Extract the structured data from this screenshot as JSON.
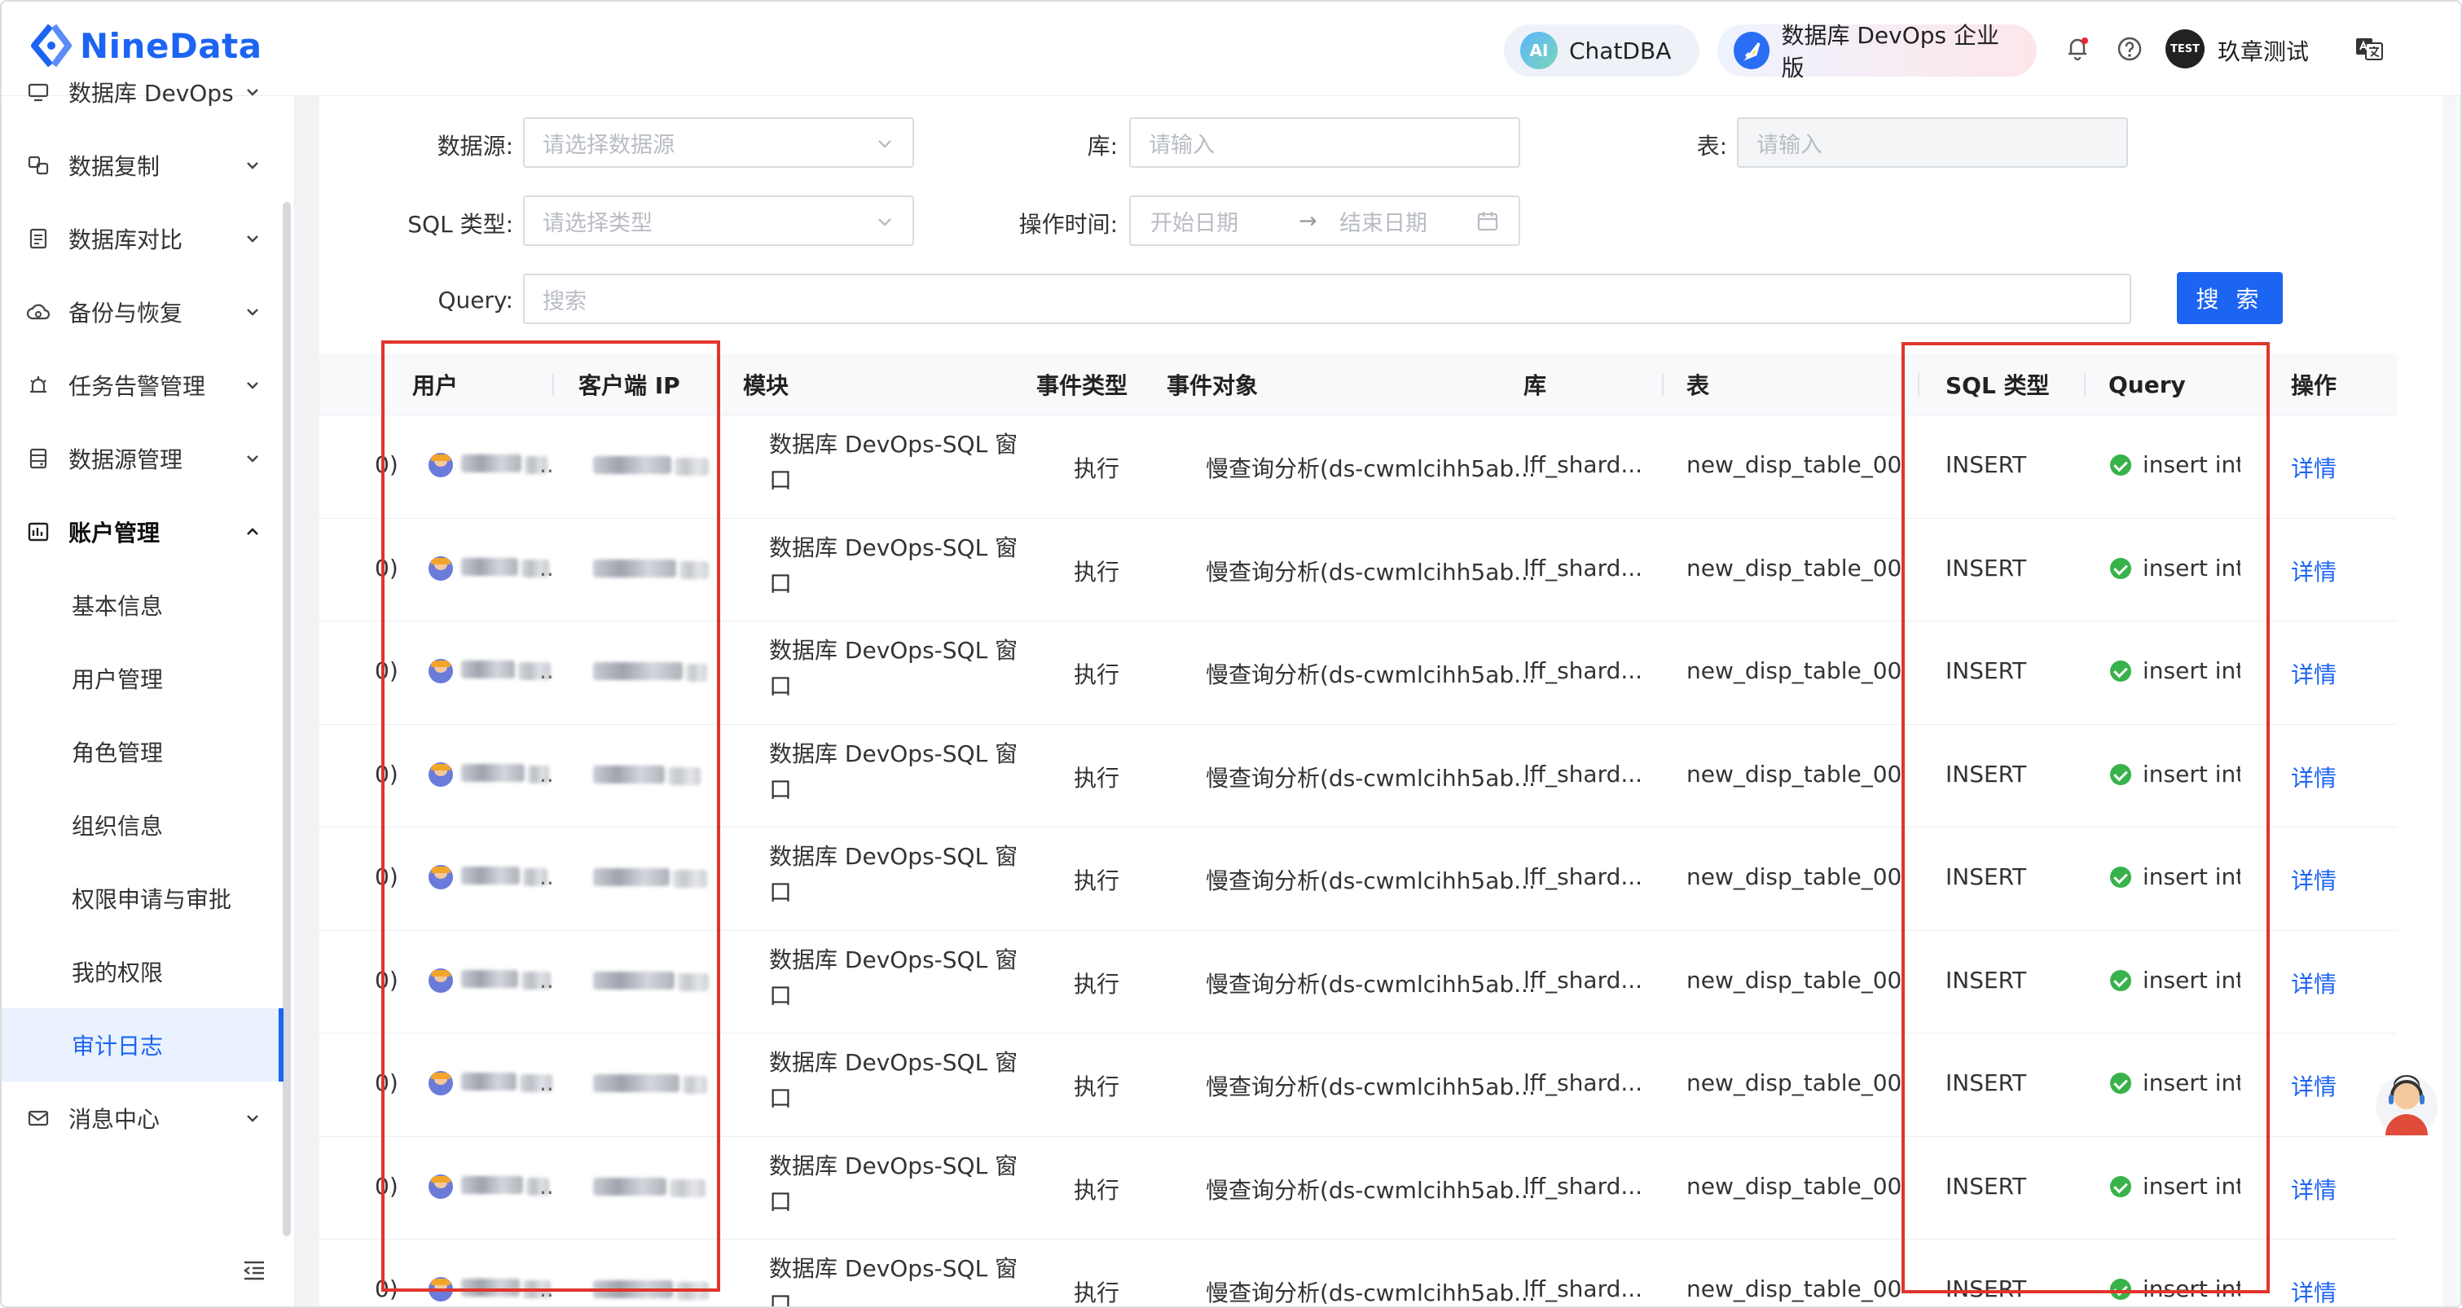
{
  "app": {
    "logo_text": "NineData",
    "brand_color": "#1c64f2"
  },
  "header": {
    "chatdba_label": "ChatDBA",
    "chatdba_icon_text": "AI",
    "devops_label": "数据库 DevOps 企业版",
    "user_badge": "TEST",
    "user_name": "玖章测试"
  },
  "sidebar": {
    "items": [
      {
        "label": "数据库 DevOps",
        "icon": "devops-icon",
        "expanded": false
      },
      {
        "label": "数据复制",
        "icon": "replication-icon",
        "expanded": false
      },
      {
        "label": "数据库对比",
        "icon": "compare-icon",
        "expanded": false
      },
      {
        "label": "备份与恢复",
        "icon": "backup-icon",
        "expanded": false
      },
      {
        "label": "任务告警管理",
        "icon": "alarm-icon",
        "expanded": false
      },
      {
        "label": "数据源管理",
        "icon": "datasource-icon",
        "expanded": false
      },
      {
        "label": "账户管理",
        "icon": "account-icon",
        "expanded": true
      },
      {
        "label": "消息中心",
        "icon": "message-icon",
        "expanded": false
      }
    ],
    "sub_items": [
      "基本信息",
      "用户管理",
      "角色管理",
      "组织信息",
      "权限申请与审批",
      "我的权限",
      "审计日志"
    ],
    "active_sub": "审计日志"
  },
  "filters": {
    "datasource_label": "数据源:",
    "datasource_placeholder": "请选择数据源",
    "db_label": "库:",
    "db_placeholder": "请输入",
    "table_label": "表:",
    "table_placeholder": "请输入",
    "sqltype_label": "SQL 类型:",
    "sqltype_placeholder": "请选择类型",
    "optime_label": "操作时间:",
    "start_placeholder": "开始日期",
    "end_placeholder": "结束日期",
    "date_separator": "→",
    "query_label": "Query:",
    "query_placeholder": "搜索",
    "search_button": "搜 索"
  },
  "table": {
    "columns": [
      "用户",
      "客户端 IP",
      "模块",
      "事件类型",
      "事件对象",
      "库",
      "表",
      "SQL 类型",
      "Query",
      "操作"
    ],
    "rows": [
      {
        "lead": "0)",
        "user_suffix": "..",
        "module": "数据库 DevOps-SQL 窗口",
        "event_type": "执行",
        "event_object": "慢查询分析(ds-cwmlcihh5ab...",
        "db": "lff_shard...",
        "table": "new_disp_table_00",
        "sql_type": "INSERT",
        "query": "insert into r",
        "action": "详情"
      },
      {
        "lead": "0)",
        "user_suffix": "..",
        "module": "数据库 DevOps-SQL 窗口",
        "event_type": "执行",
        "event_object": "慢查询分析(ds-cwmlcihh5ab...",
        "db": "lff_shard...",
        "table": "new_disp_table_00",
        "sql_type": "INSERT",
        "query": "insert into r",
        "action": "详情"
      },
      {
        "lead": "0)",
        "user_suffix": "..",
        "module": "数据库 DevOps-SQL 窗口",
        "event_type": "执行",
        "event_object": "慢查询分析(ds-cwmlcihh5ab...",
        "db": "lff_shard...",
        "table": "new_disp_table_00",
        "sql_type": "INSERT",
        "query": "insert into r",
        "action": "详情"
      },
      {
        "lead": "0)",
        "user_suffix": "..",
        "module": "数据库 DevOps-SQL 窗口",
        "event_type": "执行",
        "event_object": "慢查询分析(ds-cwmlcihh5ab...",
        "db": "lff_shard...",
        "table": "new_disp_table_00",
        "sql_type": "INSERT",
        "query": "insert into r",
        "action": "详情"
      },
      {
        "lead": "0)",
        "user_suffix": "..",
        "module": "数据库 DevOps-SQL 窗口",
        "event_type": "执行",
        "event_object": "慢查询分析(ds-cwmlcihh5ab...",
        "db": "lff_shard...",
        "table": "new_disp_table_00",
        "sql_type": "INSERT",
        "query": "insert into r",
        "action": "详情"
      },
      {
        "lead": "0)",
        "user_suffix": "..",
        "module": "数据库 DevOps-SQL 窗口",
        "event_type": "执行",
        "event_object": "慢查询分析(ds-cwmlcihh5ab...",
        "db": "lff_shard...",
        "table": "new_disp_table_00",
        "sql_type": "INSERT",
        "query": "insert into r",
        "action": "详情"
      },
      {
        "lead": "0)",
        "user_suffix": "..",
        "module": "数据库 DevOps-SQL 窗口",
        "event_type": "执行",
        "event_object": "慢查询分析(ds-cwmlcihh5ab...",
        "db": "lff_shard...",
        "table": "new_disp_table_00",
        "sql_type": "INSERT",
        "query": "insert into r",
        "action": "详情"
      },
      {
        "lead": "0)",
        "user_suffix": "..",
        "module": "数据库 DevOps-SQL 窗口",
        "event_type": "执行",
        "event_object": "慢查询分析(ds-cwmlcihh5ab...",
        "db": "lff_shard...",
        "table": "new_disp_table_00",
        "sql_type": "INSERT",
        "query": "insert into r",
        "action": "详情"
      },
      {
        "lead": "0)",
        "user_suffix": "..",
        "module": "数据库 DevOps-SQL 窗口",
        "event_type": "执行",
        "event_object": "慢查询分析(ds-cwmlcihh5ab...",
        "db": "lff_shard...",
        "table": "new_disp_table_00",
        "sql_type": "INSERT",
        "query": "insert into r",
        "action": "详情"
      }
    ]
  },
  "colors": {
    "highlight": "#e0352b",
    "success": "#38b24a",
    "link": "#1c64f2"
  }
}
